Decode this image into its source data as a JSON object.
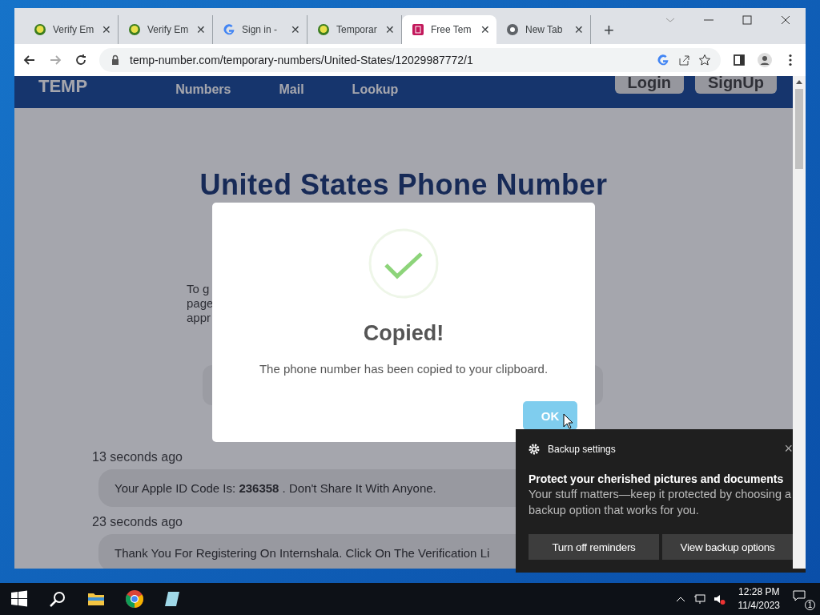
{
  "browser": {
    "tabs": [
      {
        "title": "Verify Em",
        "kind": "yellow",
        "close": "✕",
        "selected": false
      },
      {
        "title": "Verify Em",
        "kind": "yellow",
        "close": "✕",
        "selected": false
      },
      {
        "title": "Sign in -",
        "kind": "google",
        "close": "✕",
        "selected": false
      },
      {
        "title": "Temporar",
        "kind": "yellow",
        "close": "✕",
        "selected": false
      },
      {
        "title": "Free Tem",
        "kind": "pink",
        "close": "✕",
        "selected": true
      },
      {
        "title": "New Tab",
        "kind": "chrome",
        "close": "✕",
        "selected": false
      }
    ],
    "new_tab": "+",
    "url": "temp-number.com/temporary-numbers/United-States/12029987772/1"
  },
  "site": {
    "logo": "TEMP",
    "nav": [
      "Numbers",
      "Mail",
      "Lookup"
    ],
    "buttons": [
      "Login",
      "SignUp"
    ],
    "heading": "United States Phone Number",
    "intro_fragments": [
      "To g",
      "page",
      "appr"
    ],
    "messages": [
      {
        "time": "13 seconds ago",
        "text": "Your Apple ID Code Is: **236358** . Don't Share It With Anyone."
      },
      {
        "time": "23 seconds ago",
        "text": "Thank You For Registering On Internshala. Click On The Verification Li"
      }
    ]
  },
  "dialog": {
    "title": "Copied!",
    "message": "The phone number has been copied to your clipboard.",
    "ok": "OK"
  },
  "toast": {
    "app": "Backup settings",
    "close": "×",
    "title": "Protect your cherished pictures and documents",
    "body": "Your stuff matters—keep it protected by choosing a backup option that works for you.",
    "buttons": [
      "Turn off reminders",
      "View backup options"
    ]
  },
  "taskbar": {
    "time": "12:28 PM",
    "date": "11/4/2023",
    "notifications": "1"
  }
}
